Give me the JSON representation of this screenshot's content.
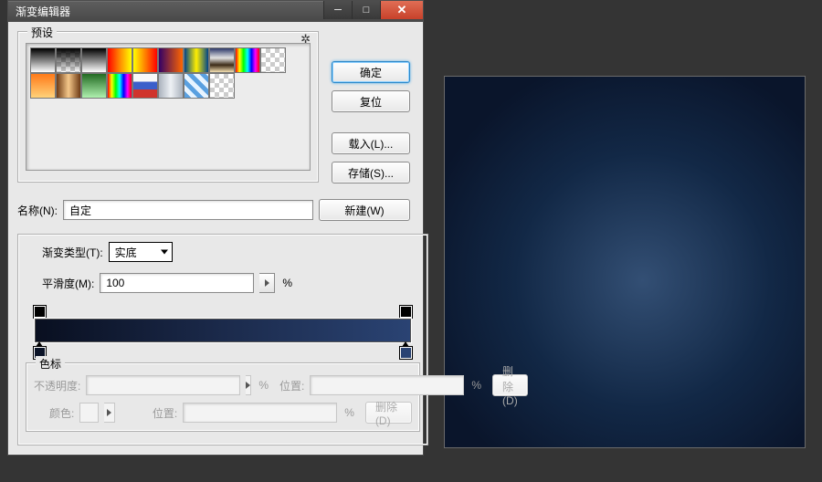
{
  "backdrop_color": "#343434",
  "window": {
    "title": "渐变编辑器",
    "buttons": {
      "min": "_",
      "max": "▢",
      "close": "X"
    }
  },
  "actions": {
    "ok": "确定",
    "cancel": "复位",
    "load": "载入(L)...",
    "save": "存储(S)..."
  },
  "presets": {
    "legend": "预设",
    "gear_icon": "✿"
  },
  "name": {
    "label": "名称(N):",
    "value": "自定",
    "new_btn": "新建(W)"
  },
  "gradient": {
    "type_label": "渐变类型(T):",
    "type_value": "实底",
    "smooth_label": "平滑度(M):",
    "smooth_value": "100",
    "percent": "%"
  },
  "stops": {
    "legend": "色标",
    "opacity_label": "不透明度:",
    "location_label": "位置:",
    "color_label": "颜色:",
    "delete_label": "删除(D)",
    "percent": "%"
  },
  "chart_data": null
}
